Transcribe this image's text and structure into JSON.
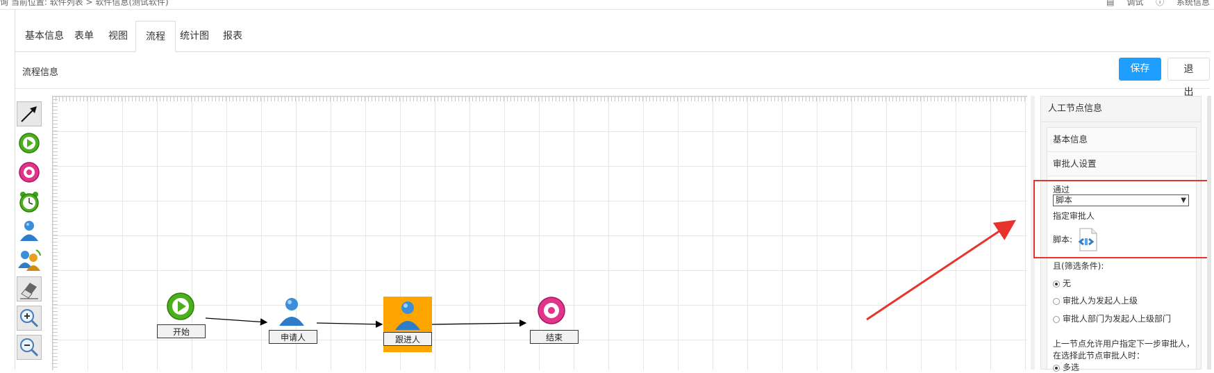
{
  "topbar": {
    "breadcrumb": "询  当前位置: 软件列表 > 软件信息(测试软件)",
    "link_debug": "调试",
    "link_help": "系统信息"
  },
  "tabs": [
    {
      "label": "基本信息"
    },
    {
      "label": "表单"
    },
    {
      "label": "视图"
    },
    {
      "label": "流程",
      "active": true
    },
    {
      "label": "统计图"
    },
    {
      "label": "报表"
    }
  ],
  "subheader": {
    "title": "流程信息",
    "save_label": "保存",
    "exit_label": "退出"
  },
  "toolbar": {
    "items": [
      {
        "icon": "arrow-select-icon"
      },
      {
        "icon": "start-node-icon"
      },
      {
        "icon": "end-node-icon"
      },
      {
        "icon": "timer-node-icon"
      },
      {
        "icon": "user-node-icon"
      },
      {
        "icon": "group-node-icon"
      },
      {
        "icon": "eraser-icon"
      },
      {
        "icon": "zoom-in-icon"
      },
      {
        "icon": "zoom-out-icon"
      }
    ]
  },
  "flow": {
    "nodes": [
      {
        "id": "start",
        "label": "开始",
        "icon": "start-node-icon"
      },
      {
        "id": "apply",
        "label": "申请人",
        "icon": "user-node-icon"
      },
      {
        "id": "follow",
        "label": "跟进人",
        "icon": "user-node-icon",
        "selected": true
      },
      {
        "id": "end",
        "label": "结束",
        "icon": "end-node-icon"
      }
    ]
  },
  "panel": {
    "title": "人工节点信息",
    "section_basic": "基本信息",
    "section_approver": "审批人设置",
    "pass_label": "通过",
    "select_value": "脚本",
    "assign_label": "指定审批人",
    "script_label": "脚本:",
    "filter_label": "且(筛选条件):",
    "radio_none": "无",
    "radio_superior": "审批人为发起人上级",
    "radio_dept": "审批人部门为发起人上级部门",
    "note_line1": "上一节点允许用户指定下一步审批人，",
    "note_line2": "在选择此节点审批人时：",
    "radio_multi": "多选"
  },
  "colors": {
    "primary": "#1e9fff",
    "highlight": "#e8332d",
    "selected_node": "#ffa500"
  }
}
